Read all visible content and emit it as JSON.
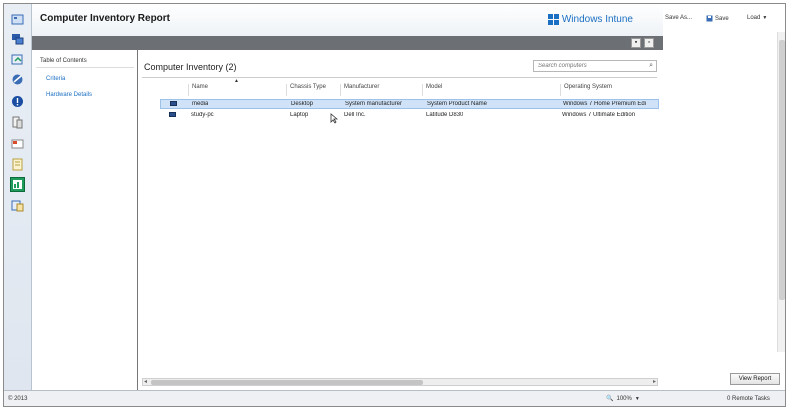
{
  "report": {
    "title": "Computer Inventory Report",
    "brand": "Windows Intune"
  },
  "toc": {
    "title": "Table of Contents",
    "items": [
      "Criteria",
      "Hardware Details"
    ]
  },
  "content": {
    "title": "Computer Inventory (2)",
    "search_placeholder": "Search computers",
    "columns": [
      "Name",
      "Chassis Type",
      "Manufacturer",
      "Model",
      "Operating System"
    ],
    "rows": [
      {
        "name": "media",
        "chassis": "Desktop",
        "manufacturer": "System manufacturer",
        "model": "System Product Name",
        "os": "Windows 7 Home Premium Edi"
      },
      {
        "name": "study-pc",
        "chassis": "Laptop",
        "manufacturer": "Dell Inc.",
        "model": "Latitude D830",
        "os": "Windows 7 Ultimate Edition"
      }
    ]
  },
  "right_panel": {
    "save_as": "Save As...",
    "save": "Save",
    "load": "Load",
    "view_report": "View Report"
  },
  "status": {
    "copyright": "© 2013",
    "zoom": "100%",
    "remote_tasks": "0 Remote Tasks"
  },
  "icons": {
    "strip": [
      "calendar-icon",
      "computers-icon",
      "updates-icon",
      "endpoint-protection-icon",
      "alerts-icon",
      "software-icon",
      "licenses-icon",
      "policy-icon",
      "reports-icon",
      "administration-icon"
    ]
  },
  "colors": {
    "accent": "#1b6fc2",
    "selected_row": "#cfe2f7",
    "active_strip_icon": "#1f9c5b"
  }
}
